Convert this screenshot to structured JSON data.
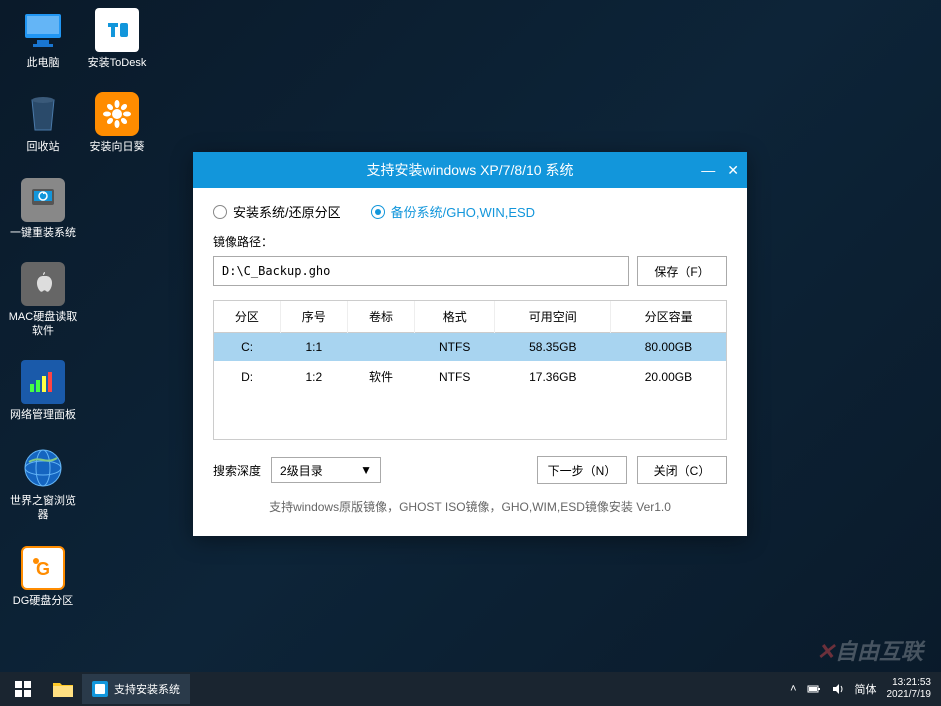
{
  "desktop": {
    "icons": [
      {
        "label": "此电脑"
      },
      {
        "label": "安装ToDesk"
      },
      {
        "label": "回收站"
      },
      {
        "label": "安装向日葵"
      },
      {
        "label": "一键重装系统"
      },
      {
        "label": "MAC硬盘读取软件"
      },
      {
        "label": "网络管理面板"
      },
      {
        "label": "世界之窗浏览器"
      },
      {
        "label": "DG硬盘分区"
      }
    ]
  },
  "window": {
    "title": "支持安装windows XP/7/8/10 系统",
    "radio": {
      "install": "安装系统/还原分区",
      "backup": "备份系统/GHO,WIN,ESD"
    },
    "path_label": "镜像路径：",
    "path_value": "D:\\C_Backup.gho",
    "save_btn": "保存（F）",
    "headers": [
      "分区",
      "序号",
      "卷标",
      "格式",
      "可用空间",
      "分区容量"
    ],
    "rows": [
      {
        "part": "C:",
        "num": "1:1",
        "vol": "",
        "fmt": "NTFS",
        "free": "58.35GB",
        "total": "80.00GB"
      },
      {
        "part": "D:",
        "num": "1:2",
        "vol": "软件",
        "fmt": "NTFS",
        "free": "17.36GB",
        "total": "20.00GB"
      }
    ],
    "depth_label": "搜索深度",
    "depth_value": "2级目录",
    "next_btn": "下一步（N）",
    "close_btn": "关闭（C）",
    "footer": "支持windows原版镜像，GHOST ISO镜像，GHO,WIM,ESD镜像安装 Ver1.0"
  },
  "taskbar": {
    "app": "支持安装系统",
    "ime": "简体",
    "time": "13:21:53",
    "date": "2021/7/19"
  },
  "watermark": "自由互联"
}
